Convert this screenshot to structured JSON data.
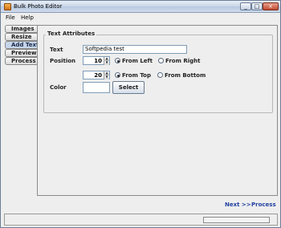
{
  "window": {
    "title": "Bulk Photo Editor"
  },
  "menu": {
    "file": "File",
    "help": "Help"
  },
  "tabs": [
    {
      "label": "Images",
      "selected": false
    },
    {
      "label": "Resize",
      "selected": false
    },
    {
      "label": "Add Text",
      "selected": true
    },
    {
      "label": "Preview",
      "selected": false
    },
    {
      "label": "Process",
      "selected": false
    }
  ],
  "text_attributes": {
    "title": "Text Attributes",
    "text_label": "Text",
    "text_value": "Softpedia test",
    "position_label": "Position",
    "x_value": "10",
    "y_value": "20",
    "from_left": "From Left",
    "from_right": "From Right",
    "from_top": "From Top",
    "from_bottom": "From Bottom",
    "horizontal_selected": "From Left",
    "vertical_selected": "From Top",
    "color_label": "Color",
    "color_value": "#ffffff",
    "select_label": "Select"
  },
  "nav": {
    "next": "Next >>",
    "process": "Process"
  },
  "status": {
    "progress": 0
  },
  "colors": {
    "link": "#1f3fa0",
    "selected_tab": "#c6d6ea"
  }
}
